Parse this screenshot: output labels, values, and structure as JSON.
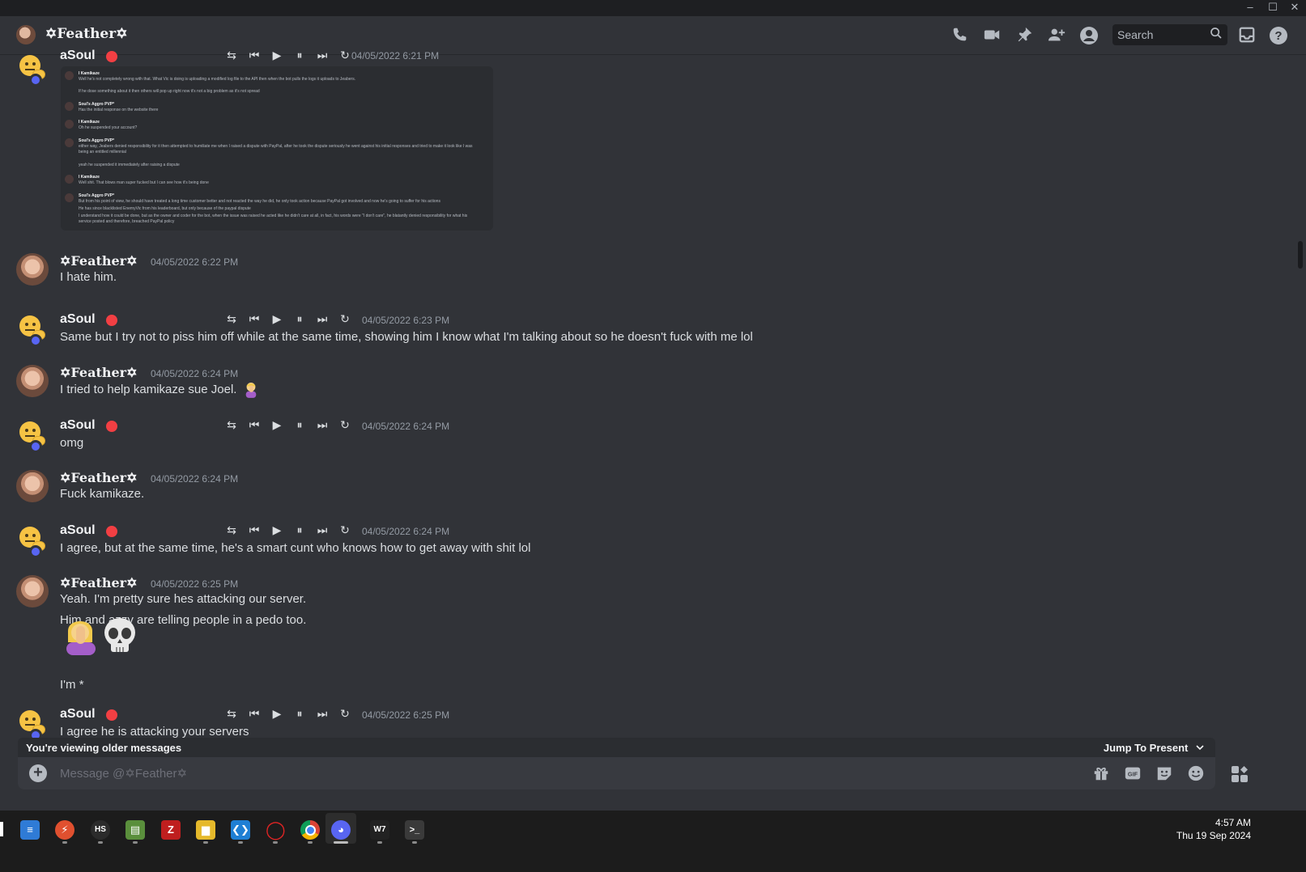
{
  "window": {
    "minimize": "–",
    "maximize": "☐",
    "close": "✕"
  },
  "header": {
    "title": "✡Feather✡",
    "search_placeholder": "Search",
    "icons": [
      "phone-icon",
      "video-icon",
      "pin-icon",
      "add-member-icon",
      "profile-icon",
      "inbox-icon",
      "help-icon"
    ]
  },
  "embed": {
    "lines": [
      {
        "name": "l Kamikaze",
        "text": "Well he's not completely wrong with that. What Vic is doing is uploading a modified log file to the API then when the bot pulls the logs it uploads to Jeabers."
      },
      {
        "name": "",
        "text": "If he dose something about it then others will pop up right now it's not a big problem as it's not spread"
      },
      {
        "name": "Soul's Aggro PVP*",
        "text": "Has the initial response on the website there"
      },
      {
        "name": "l Kamikaze",
        "text": "Oh he suspended your account?"
      },
      {
        "name": "Soul's Aggro PVP*",
        "text": "either way, Jeabers denied responsibility for it then attempted to humiliate me when I raised a dispute with PayPal, after he took the dispute seriously he went against his initial responses and tried to make it look like I was"
      },
      {
        "name": "",
        "text": "being an entitled millennial"
      },
      {
        "name": "",
        "text": "yeah he suspended it immediately after raising a dispute"
      },
      {
        "name": "l Kamikaze",
        "text": "Well shit. That blows man super fucked but I can see how it's being done"
      },
      {
        "name": "Soul's Aggro PVP*",
        "text": "But from his point of view, he should have treated a long time customer better and not reacted the way he did, he only took action because PayPal got involved and now he's going to suffer for his actions"
      },
      {
        "name": "",
        "text": "He has since blacklisted EnemyVic from his leaderboard, but only because of the paypal dispute"
      },
      {
        "name": "",
        "text": "I understand how it could be done, but as the owner and coder for the bot, when the issue was raised he acted like he didn't care at all, in fact, his words were \"I don't care\", he blatantly denied responsibility for what his"
      },
      {
        "name": "",
        "text": "service posted and therefore, breached PayPal policy"
      }
    ]
  },
  "messages": [
    {
      "author": "aSoul",
      "time": "04/05/2022 6:21 PM",
      "text": ""
    },
    {
      "author": "✡Feather✡",
      "time": "04/05/2022 6:22 PM",
      "text": "I hate him."
    },
    {
      "author": "aSoul",
      "time": "04/05/2022 6:23 PM",
      "text": "Same but I try not to piss him off while at the same time, showing him I know what I'm talking about so he doesn't fuck with me lol"
    },
    {
      "author": "✡Feather✡",
      "time": "04/05/2022 6:24 PM",
      "text": "I tried to help kamikaze sue Joel."
    },
    {
      "author": "aSoul",
      "time": "04/05/2022 6:24 PM",
      "text": "omg"
    },
    {
      "author": "✡Feather✡",
      "time": "04/05/2022 6:24 PM",
      "text": "Fuck kamikaze."
    },
    {
      "author": "aSoul",
      "time": "04/05/2022 6:24 PM",
      "text": "I agree, but at the same time, he's a smart cunt who knows how to get away with shit lol"
    },
    {
      "author": "✡Feather✡",
      "time": "04/05/2022 6:25 PM",
      "text": "Yeah. I'm pretty sure hes attacking our server.",
      "text2": "Him and azzy are telling people in a pedo too.",
      "text3": "I'm *"
    },
    {
      "author": "aSoul",
      "time": "04/05/2022 6:25 PM",
      "text": "I agree he is attacking your servers"
    }
  ],
  "controls": [
    "⇆",
    "⏮",
    "▶",
    "⏸",
    "⏭",
    "↻"
  ],
  "older_bar": {
    "text": "You're viewing older messages",
    "jump": "Jump To Present"
  },
  "composer": {
    "placeholder": "Message @✡Feather✡"
  },
  "taskbar": {
    "time": "4:57 AM",
    "date": "Thu 19 Sep 2024"
  },
  "colors": {
    "accent": "#5865f2",
    "dnd": "#f23f43",
    "bg": "#313338"
  }
}
